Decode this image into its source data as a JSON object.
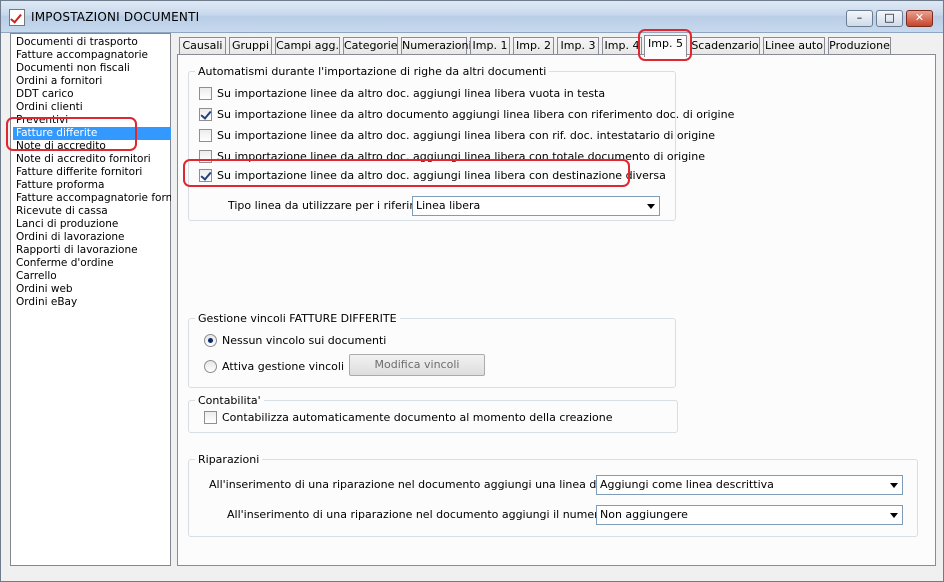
{
  "window": {
    "title": "IMPOSTAZIONI DOCUMENTI"
  },
  "title_buttons": {
    "minimize": "–",
    "maximize": "□",
    "close": "✕"
  },
  "sidebar": {
    "items": [
      "Documenti di trasporto",
      "Fatture accompagnatorie",
      "Documenti non fiscali",
      "Ordini a fornitori",
      "DDT carico",
      "Ordini clienti",
      "Preventivi",
      "Fatture differite",
      "Note di accredito",
      "Note di accredito fornitori",
      "Fatture differite fornitori",
      "Fatture proforma",
      "Fatture accompagnatorie fornitori",
      "Ricevute di cassa",
      "Lanci di produzione",
      "Ordini di lavorazione",
      "Rapporti di lavorazione",
      "Conferme d'ordine",
      "Carrello",
      "Ordini web",
      "Ordini eBay"
    ],
    "selected_index": 7
  },
  "tabs": [
    "Causali",
    "Gruppi",
    "Campi agg.",
    "Categorie",
    "Numerazioni",
    "Imp. 1",
    "Imp. 2",
    "Imp. 3",
    "Imp. 4",
    "Imp. 5",
    "Scadenzario",
    "Linee auto",
    "Produzione"
  ],
  "active_tab": "Imp. 5",
  "automatismi": {
    "title": "Automatismi durante l'importazione di righe da altri documenti",
    "checkboxes": [
      {
        "label": "Su importazione linee da altro doc. aggiungi linea libera vuota in testa",
        "checked": false
      },
      {
        "label": "Su importazione linee da altro documento aggiungi linea libera con riferimento doc. di origine",
        "checked": true
      },
      {
        "label": "Su importazione linee da altro doc. aggiungi linea libera con rif. doc. intestatario di origine",
        "checked": false
      },
      {
        "label": "Su importazione linee da altro doc. aggiungi linea libera con totale documento di origine",
        "checked": false
      },
      {
        "label": "Su importazione linee da altro doc. aggiungi linea libera con destinazione diversa",
        "checked": true
      }
    ],
    "tipo_linea_label": "Tipo linea da utilizzare per i riferimenti :",
    "tipo_linea_value": "Linea libera"
  },
  "vincoli": {
    "title": "Gestione vincoli FATTURE DIFFERITE",
    "options": [
      {
        "label": "Nessun vincolo sui documenti",
        "selected": true
      },
      {
        "label": "Attiva gestione vincoli",
        "selected": false
      }
    ],
    "modifica_button": "Modifica vincoli"
  },
  "contabilita": {
    "title": "Contabilita'",
    "checkbox_label": "Contabilizza automaticamente documento al momento della creazione",
    "checked": false
  },
  "riparazioni": {
    "title": "Riparazioni",
    "row1_label": "All'inserimento di una riparazione nel documento aggiungi una linea di riferimento :",
    "row1_value": "Aggiungi come linea descrittiva",
    "row2_label": "All'inserimento di una riparazione nel documento aggiungi il numero di matricola :",
    "row2_value": "Non aggiungere"
  },
  "colors": {
    "selection": "#3399ff",
    "annotation": "#e0262e"
  }
}
